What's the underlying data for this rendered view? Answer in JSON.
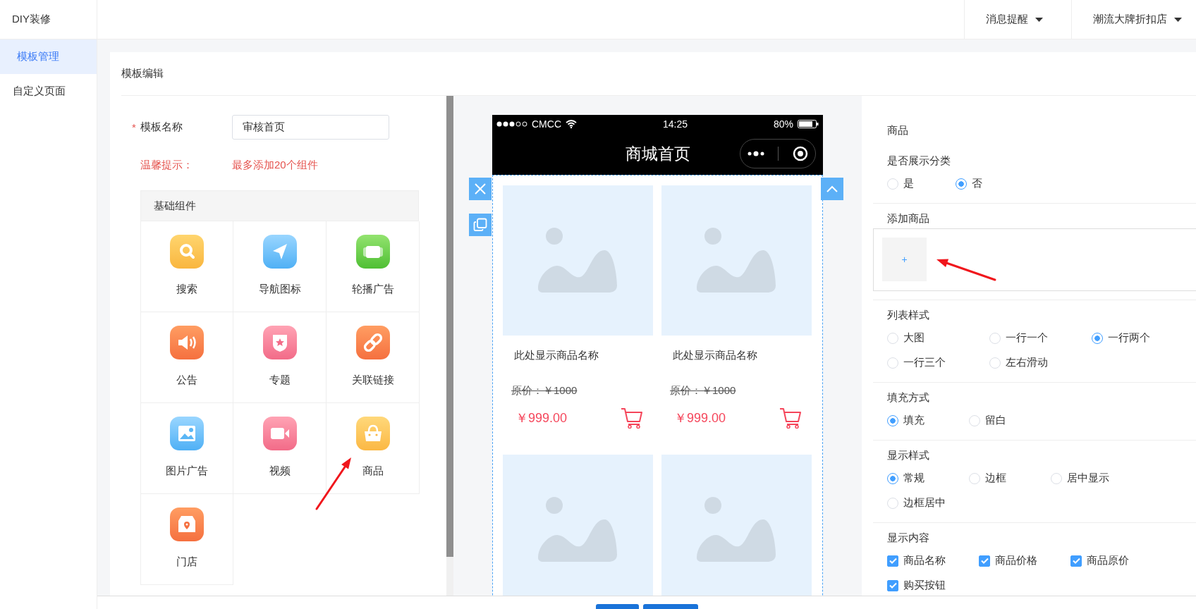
{
  "header": {
    "brand": "DIY装修",
    "menus": [
      {
        "label": "消息提醒"
      },
      {
        "label": "潮流大牌折扣店"
      }
    ]
  },
  "sidebar": {
    "items": [
      {
        "label": "模板管理",
        "selected": true
      },
      {
        "label": "自定义页面",
        "selected": false
      }
    ]
  },
  "card": {
    "title": "模板编辑"
  },
  "form": {
    "required_mark": "*",
    "name_label": "模板名称",
    "name_value": "审核首页",
    "tip_label": "温馨提示：",
    "tip_text": "最多添加20个组件"
  },
  "components": {
    "title": "基础组件",
    "items": [
      {
        "label": "搜索",
        "kind": "search"
      },
      {
        "label": "导航图标",
        "kind": "nav"
      },
      {
        "label": "轮播广告",
        "kind": "carousel"
      },
      {
        "label": "公告",
        "kind": "notice"
      },
      {
        "label": "专题",
        "kind": "topic"
      },
      {
        "label": "关联链接",
        "kind": "link"
      },
      {
        "label": "图片广告",
        "kind": "image"
      },
      {
        "label": "视频",
        "kind": "video"
      },
      {
        "label": "商品",
        "kind": "goods"
      },
      {
        "label": "门店",
        "kind": "store"
      }
    ]
  },
  "phone": {
    "carrier": "CMCC",
    "time": "14:25",
    "battery": "80%",
    "title": "商城首页",
    "products": [
      {
        "kind": "full",
        "name": "此处显示商品名称",
        "original_price": "原价：￥1000",
        "price": "￥999.00"
      },
      {
        "kind": "full",
        "name": "此处显示商品名称",
        "original_price": "原价：￥1000",
        "price": "￥999.00"
      },
      {
        "kind": "cut"
      },
      {
        "kind": "cut"
      }
    ]
  },
  "settings": {
    "title": "商品",
    "groups": [
      {
        "label": "是否展示分类",
        "kind": "radio",
        "options": [
          {
            "label": "是",
            "selected": false
          },
          {
            "label": "否",
            "selected": true
          }
        ]
      },
      {
        "label": "添加商品",
        "kind": "add",
        "add_symbol": "+"
      },
      {
        "label": "列表样式",
        "kind": "radio",
        "options": [
          {
            "label": "大图",
            "selected": false
          },
          {
            "label": "一行一个",
            "selected": false
          },
          {
            "label": "一行两个",
            "selected": true
          },
          {
            "label": "一行三个",
            "selected": false
          },
          {
            "label": "左右滑动",
            "selected": false
          }
        ]
      },
      {
        "label": "填充方式",
        "kind": "radio",
        "options": [
          {
            "label": "填充",
            "selected": true
          },
          {
            "label": "留白",
            "selected": false
          }
        ]
      },
      {
        "label": "显示样式",
        "kind": "radio",
        "options": [
          {
            "label": "常规",
            "selected": true
          },
          {
            "label": "边框",
            "selected": false
          },
          {
            "label": "居中显示",
            "selected": false
          },
          {
            "label": "边框居中",
            "selected": false
          }
        ]
      },
      {
        "label": "显示内容",
        "kind": "checkbox",
        "options": [
          {
            "label": "商品名称",
            "checked": true
          },
          {
            "label": "商品价格",
            "checked": true
          },
          {
            "label": "商品原价",
            "checked": true
          },
          {
            "label": "购买按钮",
            "checked": true
          }
        ]
      }
    ]
  }
}
